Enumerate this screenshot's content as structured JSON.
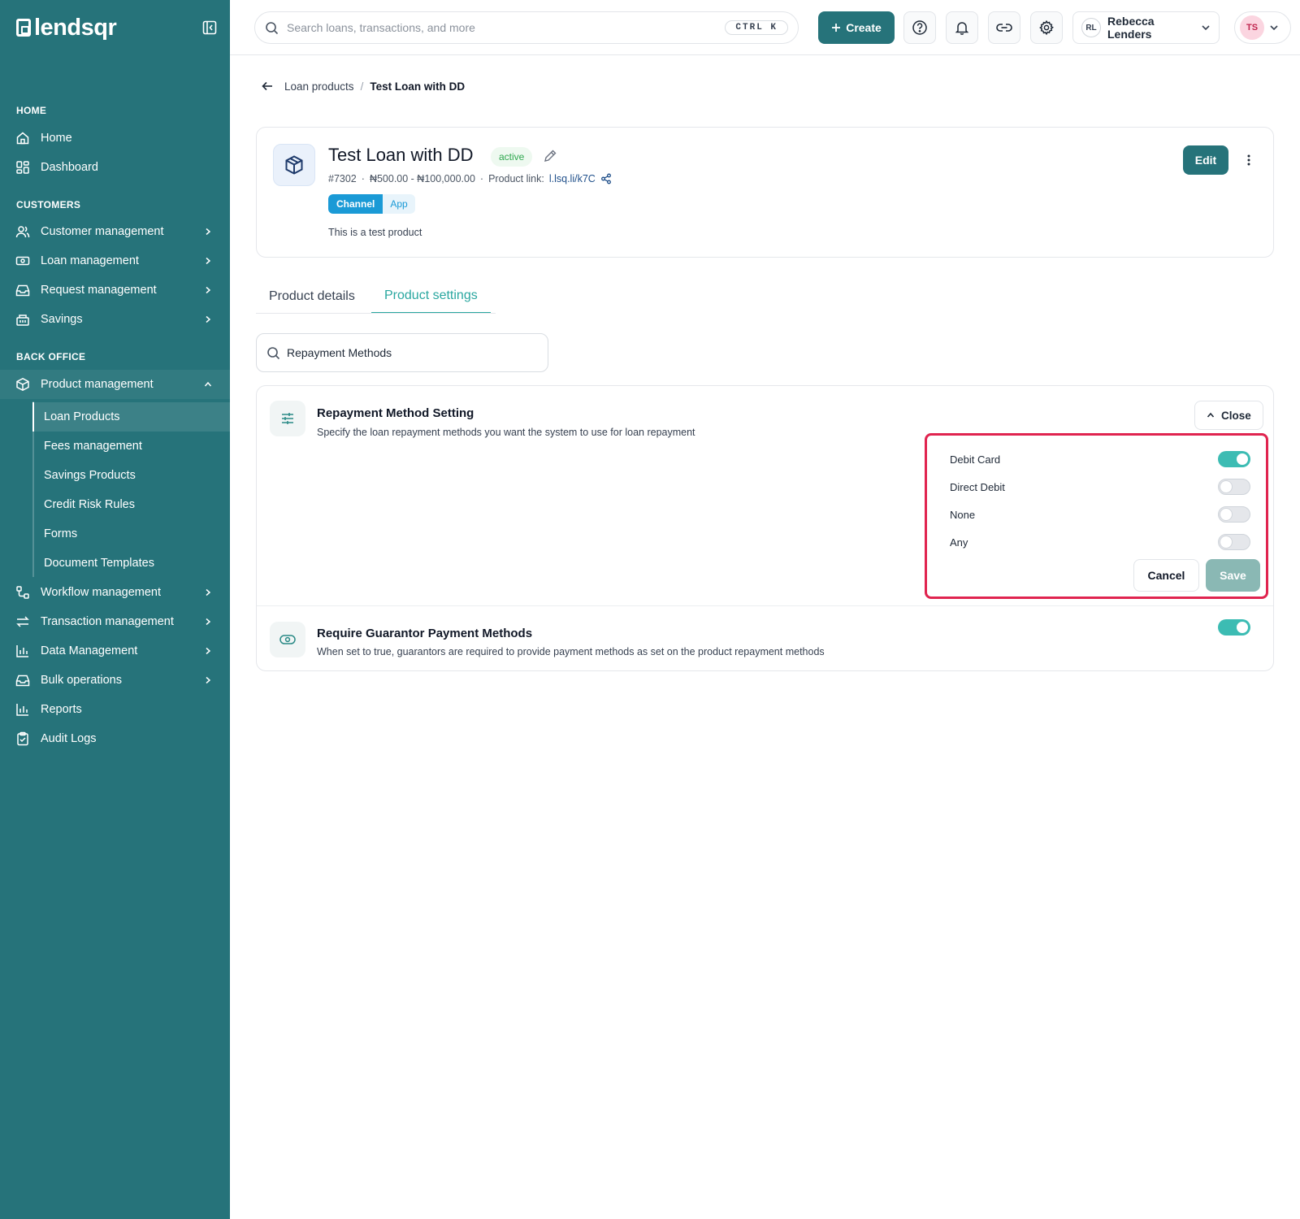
{
  "brand": {
    "name": "lendsqr"
  },
  "sidebar": {
    "sections": [
      {
        "title": "HOME"
      },
      {
        "title": "CUSTOMERS"
      },
      {
        "title": "BACK OFFICE"
      }
    ],
    "home_items": [
      {
        "label": "Home",
        "icon": "home-icon"
      },
      {
        "label": "Dashboard",
        "icon": "dashboard-icon"
      }
    ],
    "customer_items": [
      {
        "label": "Customer management",
        "icon": "users-icon"
      },
      {
        "label": "Loan management",
        "icon": "banknote-icon"
      },
      {
        "label": "Request management",
        "icon": "inbox-icon"
      },
      {
        "label": "Savings",
        "icon": "piggy-bank-icon"
      }
    ],
    "backoffice_items": [
      {
        "label": "Product management",
        "icon": "box-icon",
        "expanded": true
      },
      {
        "label": "Workflow management",
        "icon": "workflow-icon"
      },
      {
        "label": "Transaction management",
        "icon": "transfer-icon"
      },
      {
        "label": "Data Management",
        "icon": "chart-icon"
      },
      {
        "label": "Bulk operations",
        "icon": "inbox-icon"
      },
      {
        "label": "Reports",
        "icon": "chart-icon"
      },
      {
        "label": "Audit Logs",
        "icon": "clipboard-icon"
      }
    ],
    "product_sub_items": [
      {
        "label": "Loan Products",
        "active": true
      },
      {
        "label": "Fees management"
      },
      {
        "label": "Savings Products"
      },
      {
        "label": "Credit Risk Rules"
      },
      {
        "label": "Forms"
      },
      {
        "label": "Document Templates"
      }
    ]
  },
  "topbar": {
    "search_placeholder": "Search loans, transactions, and more",
    "shortcut": "CTRL K",
    "create_label": "Create",
    "org_initials": "RL",
    "org_name": "Rebecca Lenders",
    "user_initials": "TS"
  },
  "breadcrumb": {
    "parent": "Loan products",
    "separator": "/",
    "current": "Test Loan with DD"
  },
  "product": {
    "title": "Test Loan with DD",
    "status": "active",
    "id": "#7302",
    "dot": "·",
    "amount_range": "₦500.00 - ₦100,000.00",
    "link_label": "Product link:",
    "link": "l.lsq.li/k7C",
    "channel_label": "Channel",
    "channel_value": "App",
    "description": "This is a test product",
    "edit_label": "Edit"
  },
  "tabs": [
    {
      "label": "Product details",
      "active": false
    },
    {
      "label": "Product settings",
      "active": true
    }
  ],
  "settings_search": {
    "value": "Repayment Methods"
  },
  "settings": {
    "repayment": {
      "title": "Repayment Method Setting",
      "description": "Specify the loan repayment methods you want the system to use for loan repayment",
      "close_label": "Close",
      "options": [
        {
          "label": "Debit Card",
          "enabled": true
        },
        {
          "label": "Direct Debit",
          "enabled": false
        },
        {
          "label": "None",
          "enabled": false
        },
        {
          "label": "Any",
          "enabled": false
        }
      ],
      "cancel_label": "Cancel",
      "save_label": "Save"
    },
    "guarantor": {
      "title": "Require Guarantor Payment Methods",
      "description": "When set to true, guarantors are required to provide payment methods as set on the product repayment methods",
      "enabled": true
    }
  },
  "colors": {
    "sidebar": "#26737a",
    "accent": "#2aa7a0",
    "toggle_on": "#3cbcb3",
    "highlight": "#e0244f"
  }
}
